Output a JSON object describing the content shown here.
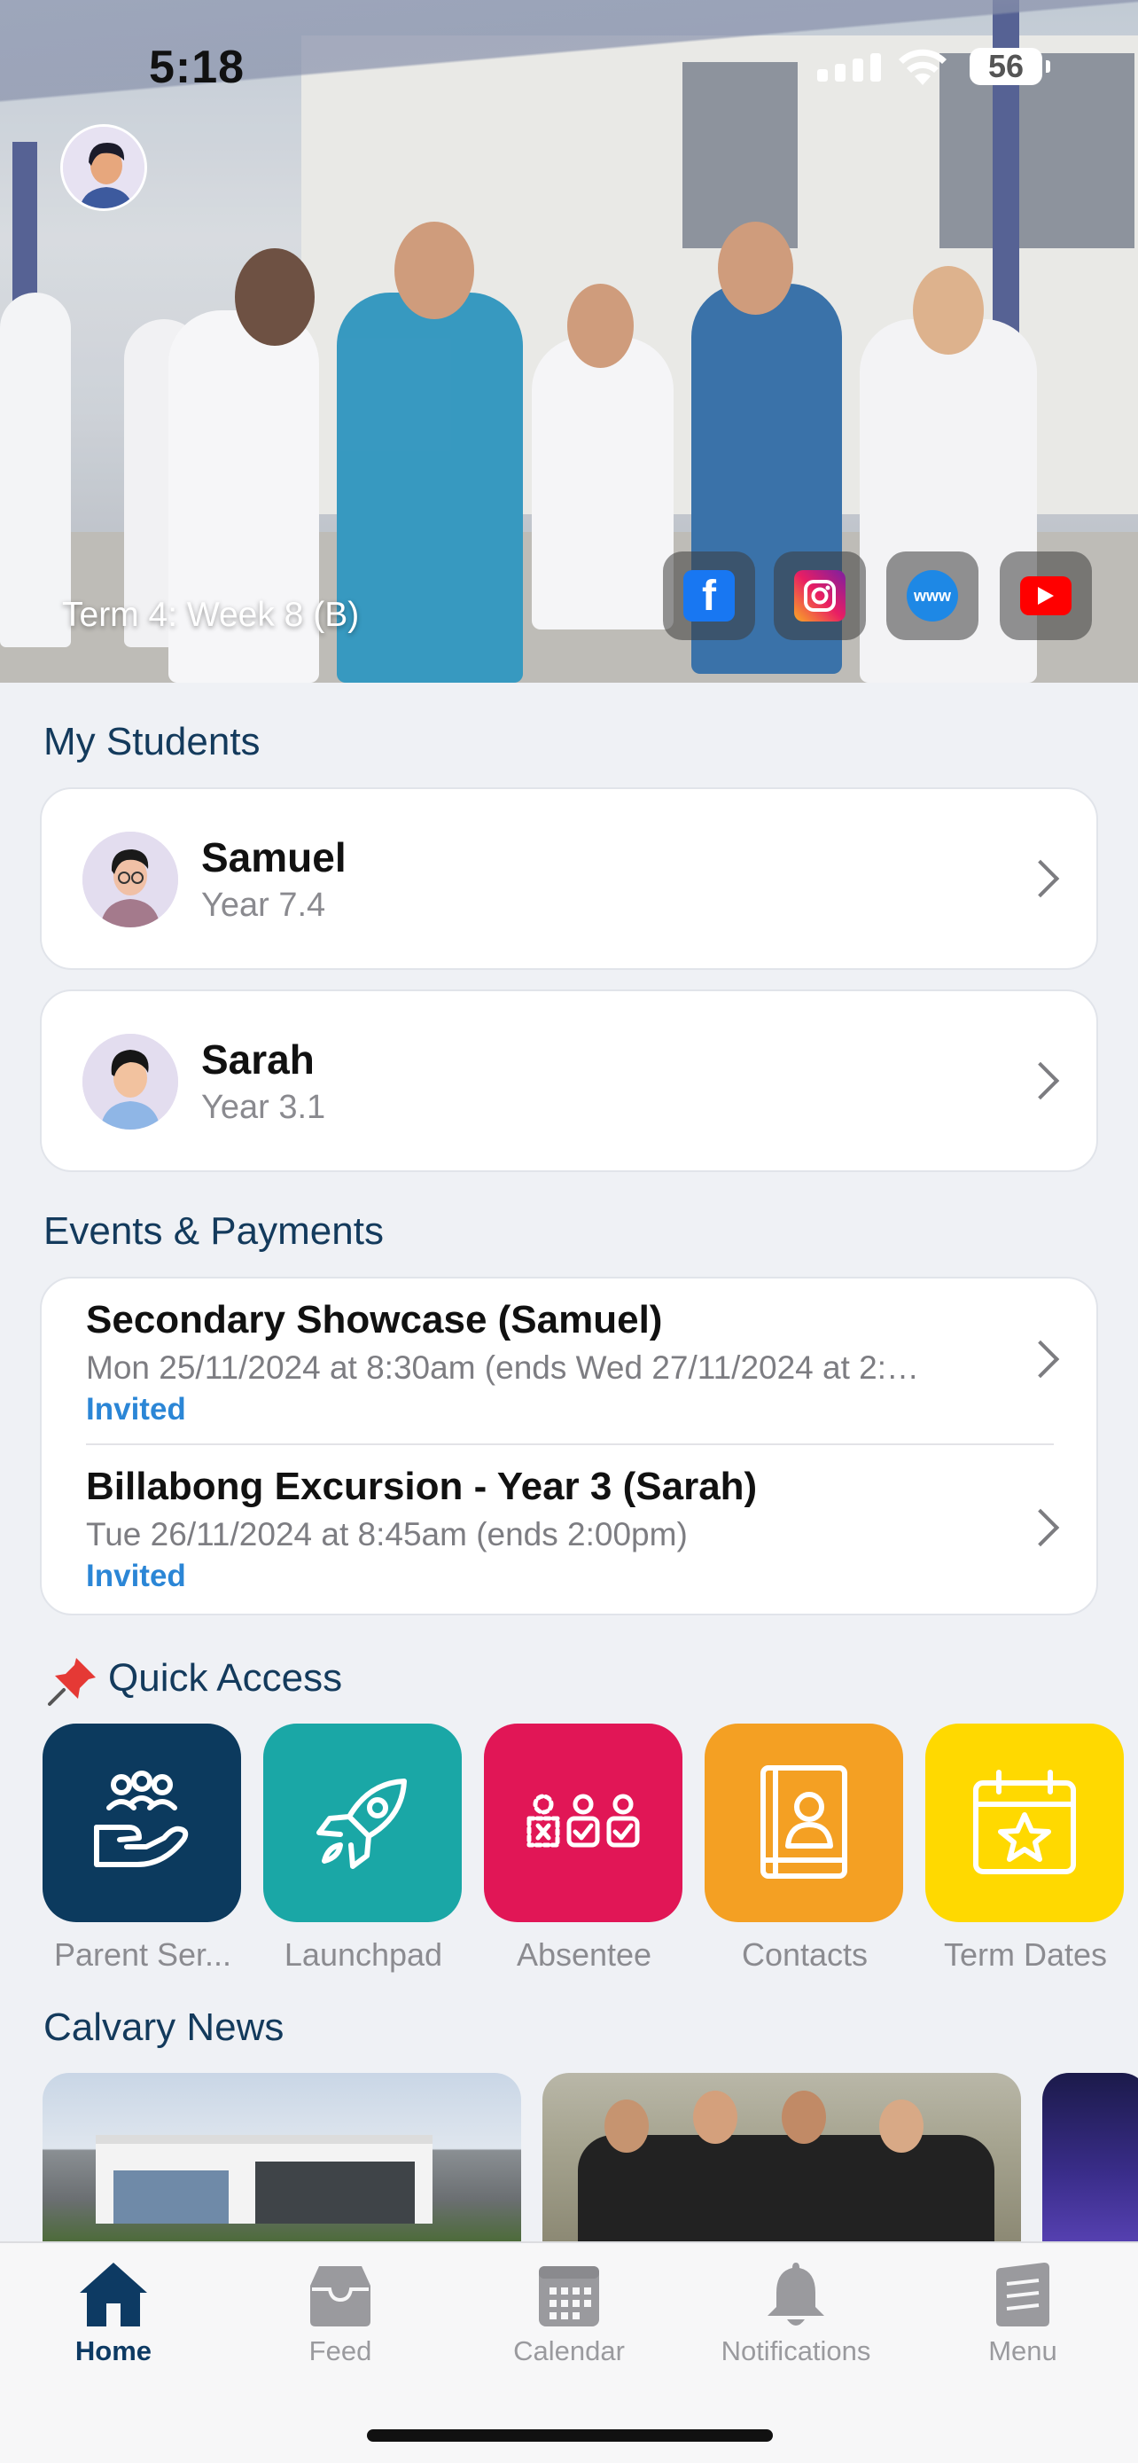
{
  "status_bar": {
    "time": "5:18",
    "battery": "56"
  },
  "hero": {
    "term_label": "Term 4: Week 8 (B)"
  },
  "social": [
    {
      "name": "facebook-icon",
      "glyph": "f",
      "color": "#1877f2"
    },
    {
      "name": "instagram-icon",
      "glyph": "◎",
      "color": "#d6249f"
    },
    {
      "name": "website-icon",
      "glyph": "www",
      "color": "#1e88e5"
    },
    {
      "name": "youtube-icon",
      "glyph": "▶",
      "color": "#ff0000"
    }
  ],
  "my_students": {
    "title": "My Students",
    "items": [
      {
        "name": "Samuel",
        "year": "Year 7.4"
      },
      {
        "name": "Sarah",
        "year": "Year 3.1"
      }
    ]
  },
  "events": {
    "title": "Events & Payments",
    "items": [
      {
        "title": "Secondary Showcase (Samuel)",
        "date": "Mon 25/11/2024 at 8:30am (ends Wed 27/11/2024 at 2:…",
        "status": "Invited"
      },
      {
        "title": "Billabong Excursion - Year 3 (Sarah)",
        "date": "Tue 26/11/2024 at 8:45am (ends 2:00pm)",
        "status": "Invited"
      }
    ]
  },
  "quick_access": {
    "title": "Quick Access",
    "items": [
      {
        "label": "Parent Ser...",
        "color": "#0c3a5e",
        "icon": "parent-services-icon"
      },
      {
        "label": "Launchpad",
        "color": "#1aa7a6",
        "icon": "rocket-icon"
      },
      {
        "label": "Absentee",
        "color": "#e11656",
        "icon": "absentee-icon"
      },
      {
        "label": "Contacts",
        "color": "#f4a023",
        "icon": "contact-book-icon"
      },
      {
        "label": "Term Dates",
        "color": "#ffd900",
        "icon": "calendar-star-icon"
      }
    ]
  },
  "news": {
    "title": "Calvary News"
  },
  "tabs": [
    {
      "label": "Home",
      "icon": "home-icon",
      "active": true
    },
    {
      "label": "Feed",
      "icon": "inbox-icon",
      "active": false
    },
    {
      "label": "Calendar",
      "icon": "calendar-icon",
      "active": false
    },
    {
      "label": "Notifications",
      "icon": "bell-icon",
      "active": false
    },
    {
      "label": "Menu",
      "icon": "menu-icon",
      "active": false
    }
  ]
}
